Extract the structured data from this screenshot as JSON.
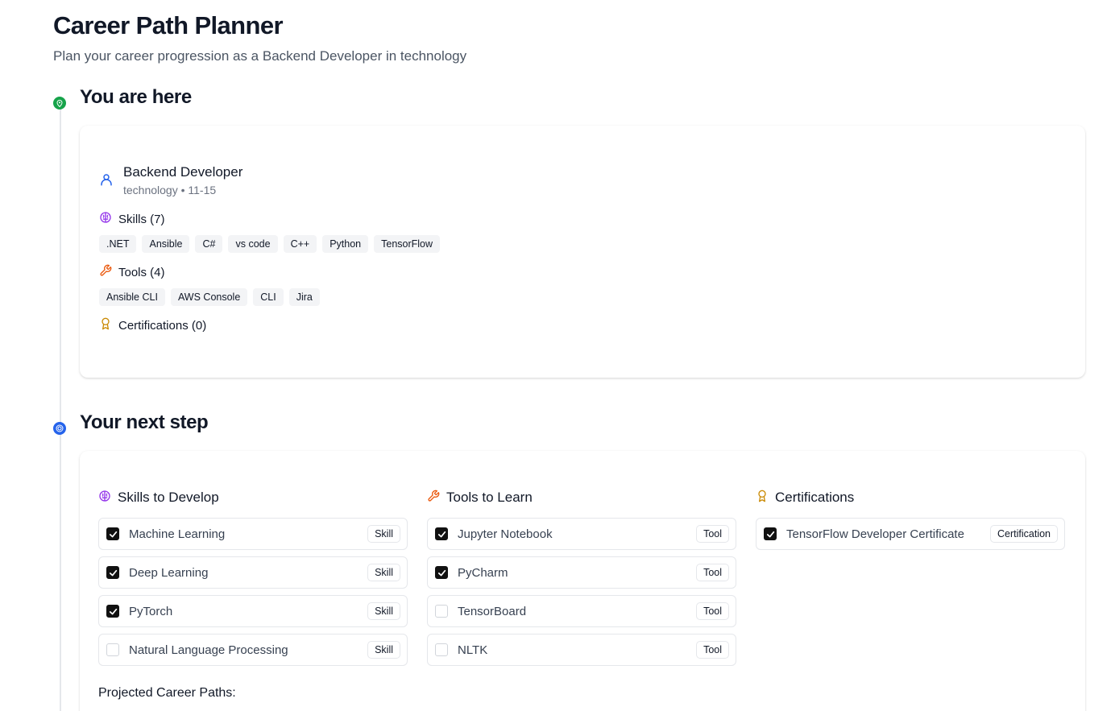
{
  "header": {
    "title": "Career Path Planner",
    "subtitle": "Plan your career progression as a Backend Developer in technology"
  },
  "current": {
    "heading": "You are here",
    "role_title": "Backend Developer",
    "role_meta": "technology • 11-15",
    "skills_label": "Skills (7)",
    "skills": [
      ".NET",
      "Ansible",
      "C#",
      "vs code",
      "C++",
      "Python",
      "TensorFlow"
    ],
    "tools_label": "Tools (4)",
    "tools": [
      "Ansible CLI",
      "AWS Console",
      "CLI",
      "Jira"
    ],
    "certs_label": "Certifications (0)"
  },
  "next": {
    "heading": "Your next step",
    "skills_header": "Skills to Develop",
    "skills": [
      {
        "label": "Machine Learning",
        "badge": "Skill",
        "checked": true
      },
      {
        "label": "Deep Learning",
        "badge": "Skill",
        "checked": true
      },
      {
        "label": "PyTorch",
        "badge": "Skill",
        "checked": true
      },
      {
        "label": "Natural Language Processing",
        "badge": "Skill",
        "checked": false
      }
    ],
    "tools_header": "Tools to Learn",
    "tools": [
      {
        "label": "Jupyter Notebook",
        "badge": "Tool",
        "checked": true
      },
      {
        "label": "PyCharm",
        "badge": "Tool",
        "checked": true
      },
      {
        "label": "TensorBoard",
        "badge": "Tool",
        "checked": false
      },
      {
        "label": "NLTK",
        "badge": "Tool",
        "checked": false
      }
    ],
    "certs_header": "Certifications",
    "certs": [
      {
        "label": "TensorFlow Developer Certificate",
        "badge": "Certification",
        "checked": true
      }
    ],
    "projected_label": "Projected Career Paths:"
  },
  "colors": {
    "current_dot": "#16a34a",
    "next_dot": "#2563eb",
    "skills_icon": "#9333ea",
    "tools_icon": "#ea580c",
    "cert_icon": "#ca8a04",
    "user_icon": "#2563eb"
  },
  "icons": {
    "current_dot": "map-pin-icon",
    "next_dot": "target-icon",
    "role": "user-icon",
    "skills": "brain-icon",
    "tools": "wrench-icon",
    "certs": "award-icon",
    "checkbox": "check-icon"
  }
}
